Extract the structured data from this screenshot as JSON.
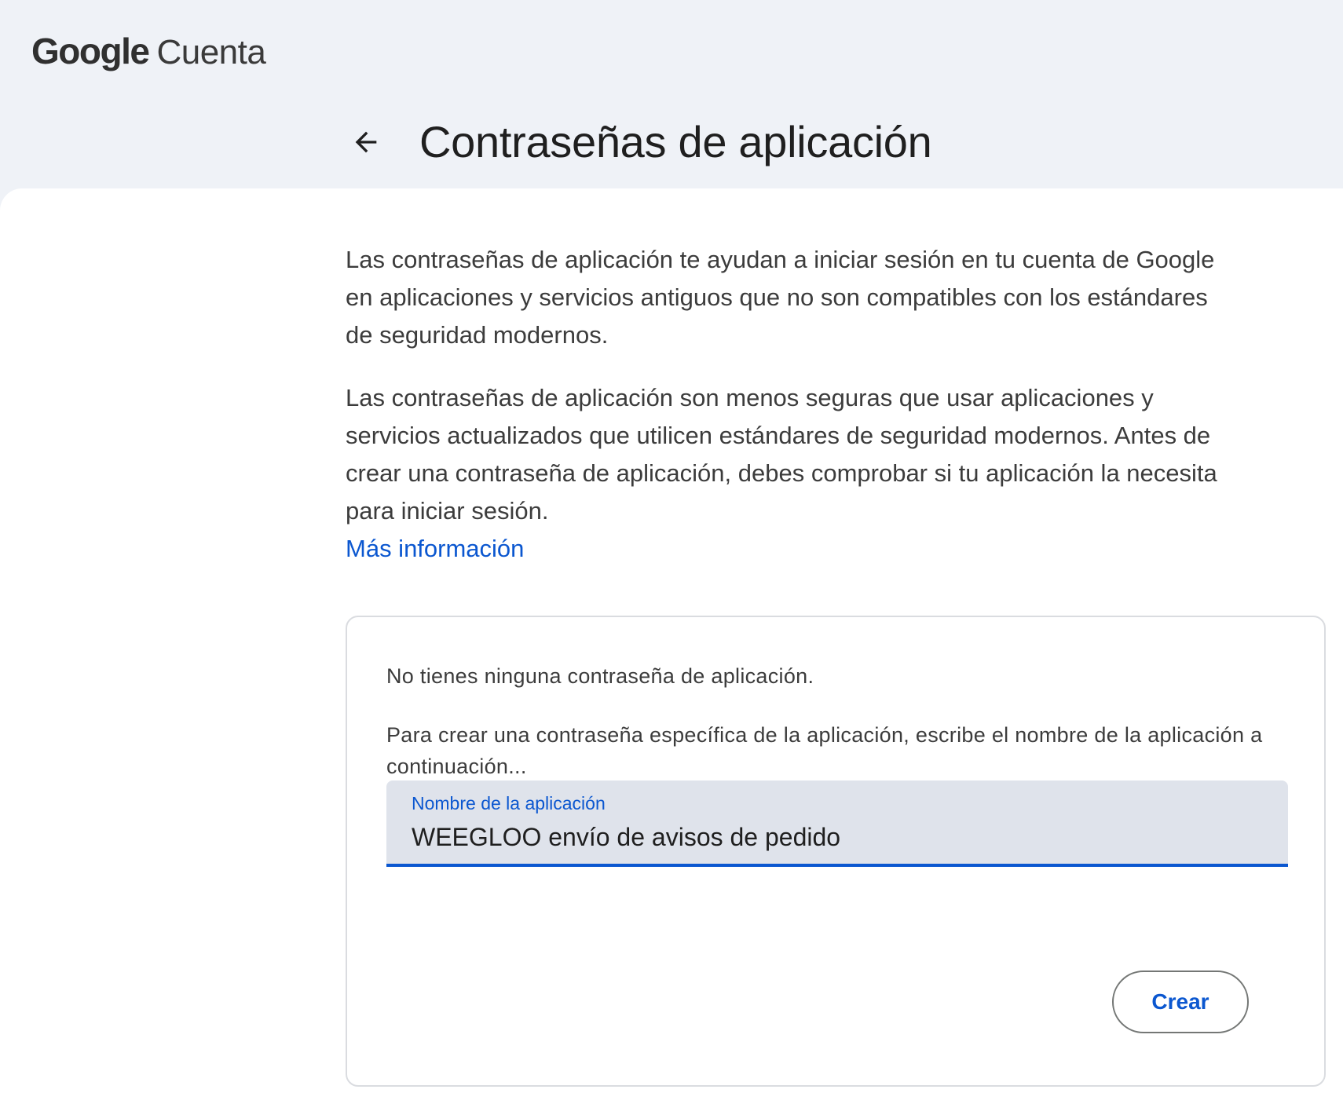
{
  "header": {
    "brand": "Google",
    "product": "Cuenta"
  },
  "page": {
    "title": "Contraseñas de aplicación",
    "back_icon": "arrow-back-icon"
  },
  "intro": {
    "paragraph1": "Las contraseñas de aplicación te ayudan a iniciar sesión en tu cuenta de Google en aplicaciones y servicios antiguos que no son compatibles con los estándares de seguridad modernos.",
    "paragraph2": "Las contraseñas de aplicación son menos seguras que usar aplicaciones y servicios actualizados que utilicen estándares de seguridad modernos. Antes de crear una contraseña de aplicación, debes comprobar si tu aplicación la necesita para iniciar sesión.",
    "link_label": "Más información"
  },
  "card": {
    "empty_message": "No tienes ninguna contraseña de aplicación.",
    "instructions": "Para crear una contraseña específica de la aplicación, escribe el nombre de la aplicación a continuación...",
    "field_label": "Nombre de la aplicación",
    "field_value": "WEEGLOO envío de avisos de pedido",
    "create_button": "Crear"
  },
  "colors": {
    "accent": "#0b57d0",
    "background": "#eff2f7",
    "field_bg": "#dfe3eb"
  }
}
